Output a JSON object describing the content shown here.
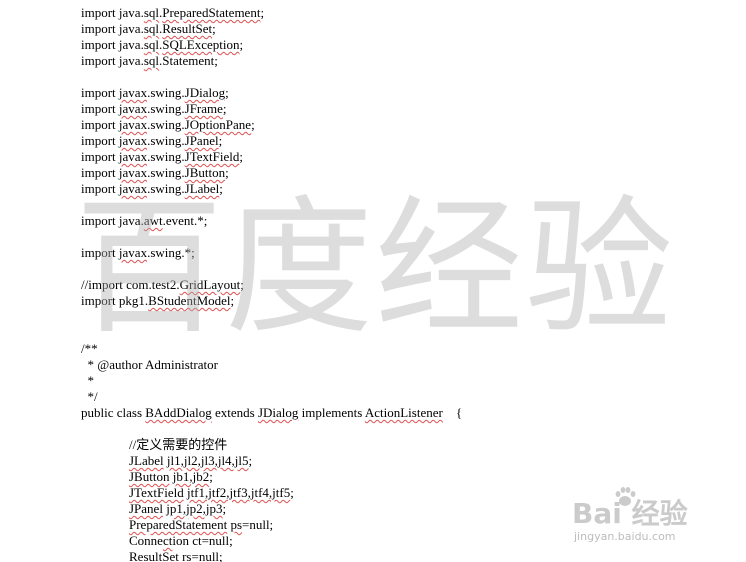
{
  "lines": [
    {
      "text": "import java.sql.PreparedStatement;",
      "squig": [
        "sql",
        "PreparedStatement"
      ]
    },
    {
      "text": "import java.sql.ResultSet;",
      "squig": [
        "sql",
        "ResultSet"
      ]
    },
    {
      "text": "import java.sql.SQLException;",
      "squig": [
        "sql",
        "SQLException"
      ]
    },
    {
      "text": "import java.sql.Statement;",
      "squig": [
        "sql"
      ]
    },
    {
      "text": "",
      "squig": []
    },
    {
      "text": "import javax.swing.JDialog;",
      "squig": [
        "javax",
        "JDialog"
      ]
    },
    {
      "text": "import javax.swing.JFrame;",
      "squig": [
        "javax",
        "JFrame"
      ]
    },
    {
      "text": "import javax.swing.JOptionPane;",
      "squig": [
        "javax",
        "JOptionPane"
      ]
    },
    {
      "text": "import javax.swing.JPanel;",
      "squig": [
        "javax",
        "JPanel"
      ]
    },
    {
      "text": "import javax.swing.JTextField;",
      "squig": [
        "javax",
        "JTextField"
      ]
    },
    {
      "text": "import javax.swing.JButton;",
      "squig": [
        "javax",
        "JButton"
      ]
    },
    {
      "text": "import javax.swing.JLabel;",
      "squig": [
        "javax",
        "JLabel"
      ]
    },
    {
      "text": "",
      "squig": []
    },
    {
      "text": "import java.awt.event.*;",
      "squig": [
        "awt"
      ]
    },
    {
      "text": "",
      "squig": []
    },
    {
      "text": "import javax.swing.*;",
      "squig": [
        "javax"
      ]
    },
    {
      "text": "",
      "squig": []
    },
    {
      "text": "//import com.test2.GridLayout;",
      "squig": [
        "GridLayout"
      ]
    },
    {
      "text": "import pkg1.BStudentModel;",
      "squig": [
        "BStudentModel"
      ]
    },
    {
      "text": "",
      "squig": []
    },
    {
      "text": "",
      "squig": []
    },
    {
      "text": "/**",
      "squig": []
    },
    {
      "text": "  * @author Administrator",
      "squig": []
    },
    {
      "text": "  *",
      "squig": []
    },
    {
      "text": "  */",
      "squig": []
    },
    {
      "text": "public class BAddDialog extends JDialog implements ActionListener    {",
      "squig": [
        "BAddDialog",
        "JDialog",
        "ActionListener"
      ]
    },
    {
      "text": "",
      "squig": []
    },
    {
      "text": "//定义需要的控件",
      "squig": [],
      "indent": true
    },
    {
      "text": "JLabel jl1,jl2,jl3,jl4,jl5;",
      "squig": [
        "JLabel",
        "jl1,jl2,jl3,jl4,jl5"
      ],
      "indent": true
    },
    {
      "text": "JButton jb1,jb2;",
      "squig": [
        "JButton",
        "jb1,jb2"
      ],
      "indent": true
    },
    {
      "text": "JTextField jtf1,jtf2,jtf3,jtf4,jtf5;",
      "squig": [
        "JTextField",
        "jtf1,jtf2,jtf3,jtf4,jtf5"
      ],
      "indent": true
    },
    {
      "text": "JPanel jp1,jp2,jp3;",
      "squig": [
        "JPanel",
        "jp1,jp2,jp3"
      ],
      "indent": true
    },
    {
      "text": "PreparedStatement ps=null;",
      "squig": [
        "PreparedStatement",
        "ps"
      ],
      "indent": true
    },
    {
      "text": "Connection ct=null;",
      "squig": [
        "ct"
      ],
      "indent": true
    },
    {
      "text": "ResultSet rs=null;",
      "squig": [
        "ResultSet",
        "rs"
      ],
      "indent": true
    }
  ],
  "watermark": {
    "text": "百度经验"
  },
  "logo": {
    "brand": "Bai 经验",
    "url": "jingyan.baidu.com"
  },
  "colors": {
    "text": "#000000",
    "squiggle": "#e05050",
    "watermark": "#afafaf"
  }
}
